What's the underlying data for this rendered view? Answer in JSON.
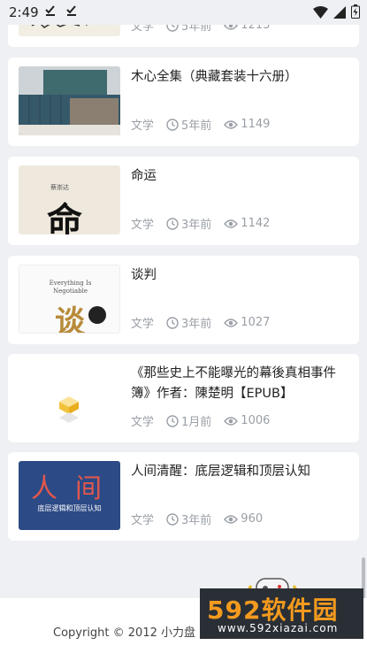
{
  "status_bar": {
    "time": "2:49"
  },
  "articles": [
    {
      "title": "",
      "category": "文学",
      "time": "5年前",
      "views": "1213"
    },
    {
      "title": "木心全集（典藏套装十六册）",
      "category": "文学",
      "time": "5年前",
      "views": "1149"
    },
    {
      "title": "命运",
      "category": "文学",
      "time": "3年前",
      "views": "1142",
      "thumb_text": "命",
      "thumb_author": "蔡崇达"
    },
    {
      "title": "谈判",
      "category": "文学",
      "time": "3年前",
      "views": "1027",
      "thumb_text": "谈",
      "thumb_en": "Everything Is Negotiable"
    },
    {
      "title": "《那些史上不能曝光的幕後真相事件簿》作者：陳楚明【EPUB】",
      "category": "文学",
      "time": "1月前",
      "views": "1006"
    },
    {
      "title": "人间清醒：底层逻辑和顶层认知",
      "category": "文学",
      "time": "3年前",
      "views": "960",
      "thumb_text": "人间",
      "thumb_sub": "底层逻辑和顶层认知"
    }
  ],
  "footer": {
    "copyright": "Copyright © 2012  小力盘"
  },
  "watermark": {
    "brand": "592软件园",
    "url": "www.592xiazai.com"
  },
  "colors": {
    "background": "#eef0f3",
    "meta_text": "#9a9fa6",
    "watermark_orange": "#f39a1e"
  }
}
